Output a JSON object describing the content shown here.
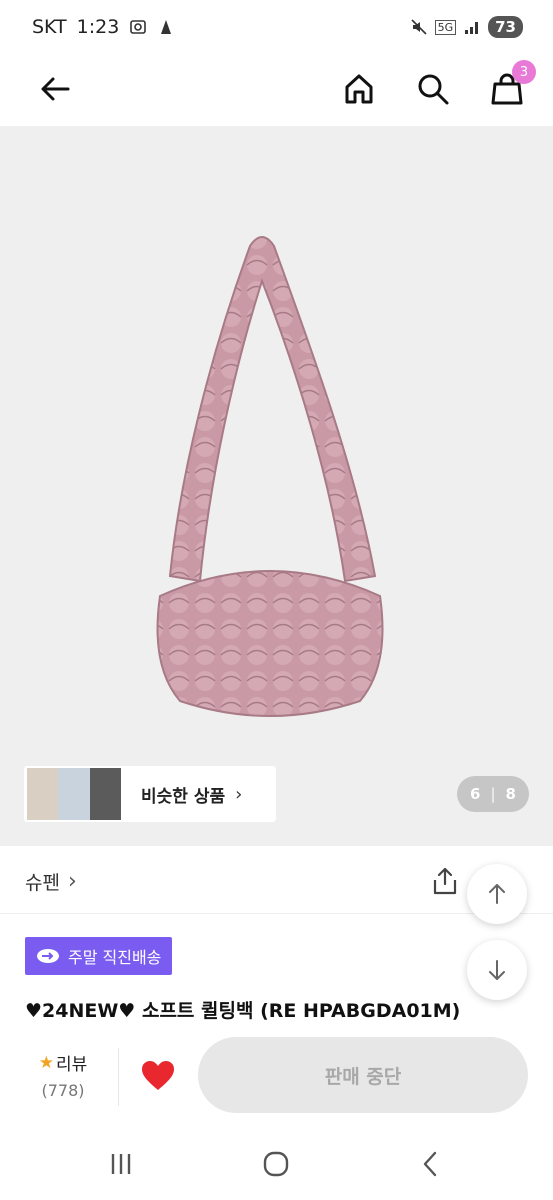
{
  "status_bar": {
    "carrier": "SKT",
    "time": "1:23",
    "network": "5G",
    "battery": "73"
  },
  "header": {
    "icons": [
      "arrow-left-icon",
      "home-icon",
      "search-icon",
      "shopping-bag-icon"
    ],
    "cart_count": "3"
  },
  "gallery": {
    "similar_label": "비슷한 상품",
    "similar_chevron": "›",
    "current": "6",
    "separator": "|",
    "total": "8"
  },
  "product": {
    "brand": "슈펜",
    "brand_chevron": "›",
    "shipping_badge": "주말 직진배송",
    "title": "♥24NEW♥ 소프트 퀼팅백 (RE HPABGDA01M)"
  },
  "action_bar": {
    "review_label": "리뷰",
    "review_count": "(778)",
    "buy_label": "판매 중단"
  },
  "colors": {
    "badge_purple": "#7b5cf0",
    "cart_badge_pink": "#e879d6",
    "heart_red": "#e8272f",
    "star_orange": "#f0a324",
    "bag_pink": "#c99aa6"
  }
}
